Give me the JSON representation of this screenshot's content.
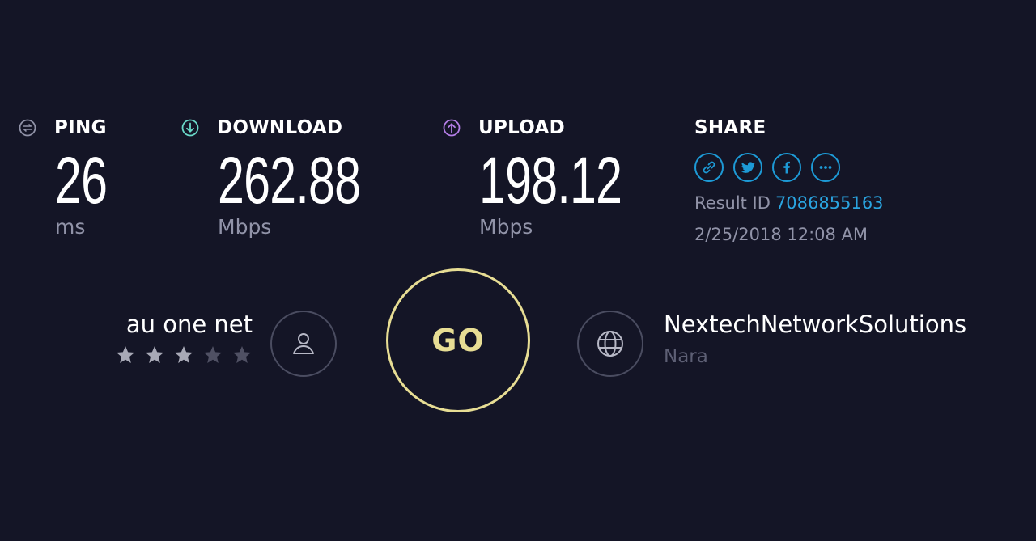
{
  "metrics": {
    "ping": {
      "label": "PING",
      "value": "26",
      "unit": "ms",
      "icon": "ping-icon"
    },
    "download": {
      "label": "DOWNLOAD",
      "value": "262.88",
      "unit": "Mbps",
      "icon": "download-icon"
    },
    "upload": {
      "label": "UPLOAD",
      "value": "198.12",
      "unit": "Mbps",
      "icon": "upload-icon"
    }
  },
  "share": {
    "label": "SHARE",
    "buttons": [
      "link-icon",
      "twitter-icon",
      "facebook-icon",
      "more-icon"
    ],
    "result_label": "Result ID",
    "result_id": "7086855163",
    "date": "2/25/2018 12:08 AM"
  },
  "isp": {
    "name": "au one net",
    "rating": 3,
    "max_rating": 5
  },
  "go": {
    "label": "GO"
  },
  "server": {
    "name": "NextechNetworkSolutions",
    "location": "Nara"
  },
  "colors": {
    "background": "#141526",
    "ping_accent": "#9193a8",
    "download_accent": "#6ad9c9",
    "upload_accent": "#b57ee8",
    "share_accent": "#1d9ad6",
    "go_ring": "#e7dd94"
  }
}
